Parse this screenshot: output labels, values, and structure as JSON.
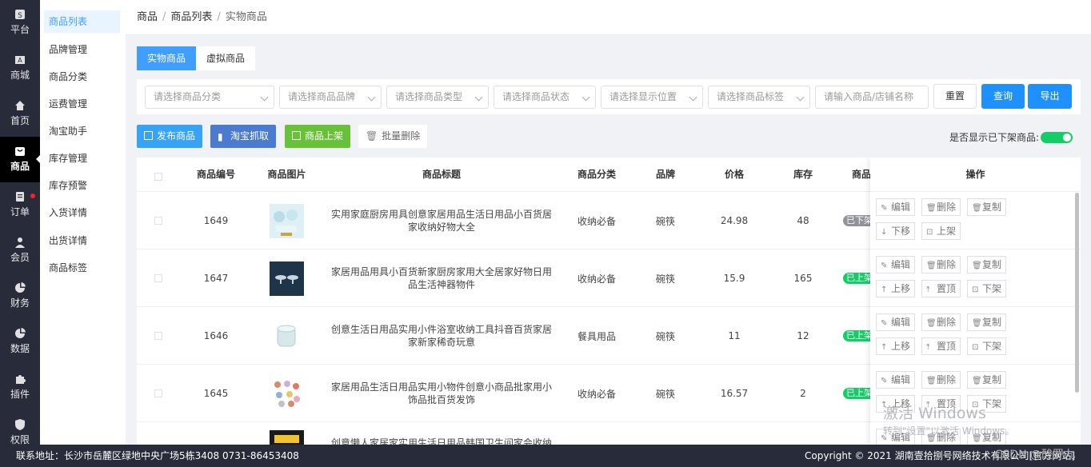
{
  "rail": [
    {
      "label": "平台",
      "icon": "platform-icon"
    },
    {
      "label": "商城",
      "icon": "mall-icon"
    },
    {
      "label": "首页",
      "icon": "home-icon"
    },
    {
      "label": "商品",
      "icon": "goods-icon"
    },
    {
      "label": "订单",
      "icon": "order-icon"
    },
    {
      "label": "会员",
      "icon": "member-icon"
    },
    {
      "label": "财务",
      "icon": "finance-icon"
    },
    {
      "label": "数据",
      "icon": "data-icon"
    },
    {
      "label": "插件",
      "icon": "plugin-icon"
    },
    {
      "label": "权限",
      "icon": "permission-icon"
    }
  ],
  "submenu": [
    "商品列表",
    "品牌管理",
    "商品分类",
    "运费管理",
    "淘宝助手",
    "库存管理",
    "库存预警",
    "入货详情",
    "出货详情",
    "商品标签"
  ],
  "breadcrumb": [
    "商品",
    "商品列表",
    "实物商品"
  ],
  "tabs": [
    "实物商品",
    "虚拟商品"
  ],
  "filters": {
    "category": "请选择商品分类",
    "brand": "请选择商品品牌",
    "type": "请选择商品类型",
    "status": "请选择商品状态",
    "position": "请选择显示位置",
    "tag": "请选择商品标签",
    "keyword": "请输入商品/店铺名称",
    "reset": "重置",
    "query": "查询",
    "export": "导出"
  },
  "actions": {
    "publish": "发布商品",
    "taobao": "淘宝抓取",
    "shelf": "商品上架",
    "batch_delete": "批量删除",
    "show_off_label": "是否显示已下架商品:"
  },
  "colors": {
    "primary": "#1e90ff",
    "publish": "#36a3f7",
    "taobao": "#4a7bd0",
    "shelf": "#67c23a",
    "on": "#13ce66",
    "off": "#909399"
  },
  "table": {
    "headers": [
      "商品编号",
      "商品图片",
      "商品标题",
      "商品分类",
      "品牌",
      "价格",
      "库存",
      "商品",
      "操作"
    ],
    "rows": [
      {
        "id": "1649",
        "title": "实用家庭厨房用具创意家居用品生活日用品小百货居家收纳好物大全",
        "category": "收纳必备",
        "brand": "碗筷",
        "price": "24.98",
        "stock": "48",
        "status": "已下架",
        "ops2": [
          "下移",
          "上架"
        ]
      },
      {
        "id": "1647",
        "title": "家居用品用具小百货新家厨房家用大全居家好物日用品生活神器物件",
        "category": "收纳必备",
        "brand": "碗筷",
        "price": "15.9",
        "stock": "165",
        "status": "已上架",
        "ops2": [
          "上移",
          "置顶",
          "下架"
        ]
      },
      {
        "id": "1646",
        "title": "创意生活日用品实用小件浴室收纳工具抖音百货家居家新家稀奇玩意",
        "category": "餐具用品",
        "brand": "碗筷",
        "price": "11",
        "stock": "12",
        "status": "已上架",
        "ops2": [
          "上移",
          "置顶",
          "下架"
        ]
      },
      {
        "id": "1645",
        "title": "家居用品生活日用品实用小物件创意小商品批家用小饰品批百货发饰",
        "category": "收纳必备",
        "brand": "碗筷",
        "price": "16.57",
        "stock": "2",
        "status": "已上架",
        "ops2": [
          "上移",
          "置顶",
          "下架"
        ]
      },
      {
        "id": "",
        "title": "创意懒人家居家实用生活日用品韩国卫生间家会收纳",
        "category": "",
        "brand": "",
        "price": "",
        "stock": "",
        "status": "",
        "ops2": []
      }
    ],
    "ops1": [
      "编辑",
      "删除",
      "复制"
    ]
  },
  "footer": {
    "address": "联系地址：长沙市岳麓区绿地中央广场5栋3408 0731-86453408",
    "copyright": "Copyright © 2021 湖南壹拾捌号网络技术有限公司[官方网站]"
  },
  "watermark": {
    "title": "激活 Windows",
    "sub": "转到\"设置\"以激活 Windows。",
    "csdn": "CSDN @酸罗丸"
  }
}
